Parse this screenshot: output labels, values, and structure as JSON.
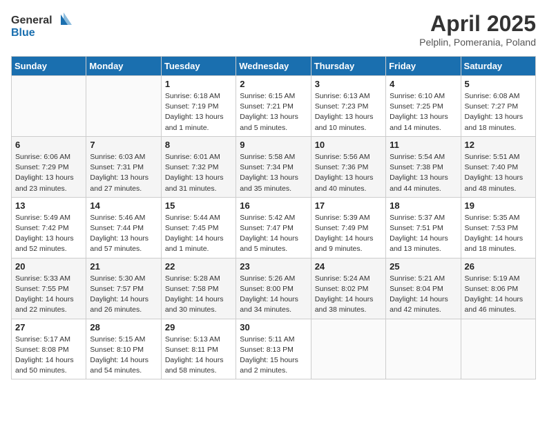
{
  "header": {
    "logo_general": "General",
    "logo_blue": "Blue",
    "month": "April 2025",
    "location": "Pelplin, Pomerania, Poland"
  },
  "weekdays": [
    "Sunday",
    "Monday",
    "Tuesday",
    "Wednesday",
    "Thursday",
    "Friday",
    "Saturday"
  ],
  "weeks": [
    [
      {
        "day": "",
        "info": ""
      },
      {
        "day": "",
        "info": ""
      },
      {
        "day": "1",
        "info": "Sunrise: 6:18 AM\nSunset: 7:19 PM\nDaylight: 13 hours and 1 minute."
      },
      {
        "day": "2",
        "info": "Sunrise: 6:15 AM\nSunset: 7:21 PM\nDaylight: 13 hours and 5 minutes."
      },
      {
        "day": "3",
        "info": "Sunrise: 6:13 AM\nSunset: 7:23 PM\nDaylight: 13 hours and 10 minutes."
      },
      {
        "day": "4",
        "info": "Sunrise: 6:10 AM\nSunset: 7:25 PM\nDaylight: 13 hours and 14 minutes."
      },
      {
        "day": "5",
        "info": "Sunrise: 6:08 AM\nSunset: 7:27 PM\nDaylight: 13 hours and 18 minutes."
      }
    ],
    [
      {
        "day": "6",
        "info": "Sunrise: 6:06 AM\nSunset: 7:29 PM\nDaylight: 13 hours and 23 minutes."
      },
      {
        "day": "7",
        "info": "Sunrise: 6:03 AM\nSunset: 7:31 PM\nDaylight: 13 hours and 27 minutes."
      },
      {
        "day": "8",
        "info": "Sunrise: 6:01 AM\nSunset: 7:32 PM\nDaylight: 13 hours and 31 minutes."
      },
      {
        "day": "9",
        "info": "Sunrise: 5:58 AM\nSunset: 7:34 PM\nDaylight: 13 hours and 35 minutes."
      },
      {
        "day": "10",
        "info": "Sunrise: 5:56 AM\nSunset: 7:36 PM\nDaylight: 13 hours and 40 minutes."
      },
      {
        "day": "11",
        "info": "Sunrise: 5:54 AM\nSunset: 7:38 PM\nDaylight: 13 hours and 44 minutes."
      },
      {
        "day": "12",
        "info": "Sunrise: 5:51 AM\nSunset: 7:40 PM\nDaylight: 13 hours and 48 minutes."
      }
    ],
    [
      {
        "day": "13",
        "info": "Sunrise: 5:49 AM\nSunset: 7:42 PM\nDaylight: 13 hours and 52 minutes."
      },
      {
        "day": "14",
        "info": "Sunrise: 5:46 AM\nSunset: 7:44 PM\nDaylight: 13 hours and 57 minutes."
      },
      {
        "day": "15",
        "info": "Sunrise: 5:44 AM\nSunset: 7:45 PM\nDaylight: 14 hours and 1 minute."
      },
      {
        "day": "16",
        "info": "Sunrise: 5:42 AM\nSunset: 7:47 PM\nDaylight: 14 hours and 5 minutes."
      },
      {
        "day": "17",
        "info": "Sunrise: 5:39 AM\nSunset: 7:49 PM\nDaylight: 14 hours and 9 minutes."
      },
      {
        "day": "18",
        "info": "Sunrise: 5:37 AM\nSunset: 7:51 PM\nDaylight: 14 hours and 13 minutes."
      },
      {
        "day": "19",
        "info": "Sunrise: 5:35 AM\nSunset: 7:53 PM\nDaylight: 14 hours and 18 minutes."
      }
    ],
    [
      {
        "day": "20",
        "info": "Sunrise: 5:33 AM\nSunset: 7:55 PM\nDaylight: 14 hours and 22 minutes."
      },
      {
        "day": "21",
        "info": "Sunrise: 5:30 AM\nSunset: 7:57 PM\nDaylight: 14 hours and 26 minutes."
      },
      {
        "day": "22",
        "info": "Sunrise: 5:28 AM\nSunset: 7:58 PM\nDaylight: 14 hours and 30 minutes."
      },
      {
        "day": "23",
        "info": "Sunrise: 5:26 AM\nSunset: 8:00 PM\nDaylight: 14 hours and 34 minutes."
      },
      {
        "day": "24",
        "info": "Sunrise: 5:24 AM\nSunset: 8:02 PM\nDaylight: 14 hours and 38 minutes."
      },
      {
        "day": "25",
        "info": "Sunrise: 5:21 AM\nSunset: 8:04 PM\nDaylight: 14 hours and 42 minutes."
      },
      {
        "day": "26",
        "info": "Sunrise: 5:19 AM\nSunset: 8:06 PM\nDaylight: 14 hours and 46 minutes."
      }
    ],
    [
      {
        "day": "27",
        "info": "Sunrise: 5:17 AM\nSunset: 8:08 PM\nDaylight: 14 hours and 50 minutes."
      },
      {
        "day": "28",
        "info": "Sunrise: 5:15 AM\nSunset: 8:10 PM\nDaylight: 14 hours and 54 minutes."
      },
      {
        "day": "29",
        "info": "Sunrise: 5:13 AM\nSunset: 8:11 PM\nDaylight: 14 hours and 58 minutes."
      },
      {
        "day": "30",
        "info": "Sunrise: 5:11 AM\nSunset: 8:13 PM\nDaylight: 15 hours and 2 minutes."
      },
      {
        "day": "",
        "info": ""
      },
      {
        "day": "",
        "info": ""
      },
      {
        "day": "",
        "info": ""
      }
    ]
  ]
}
